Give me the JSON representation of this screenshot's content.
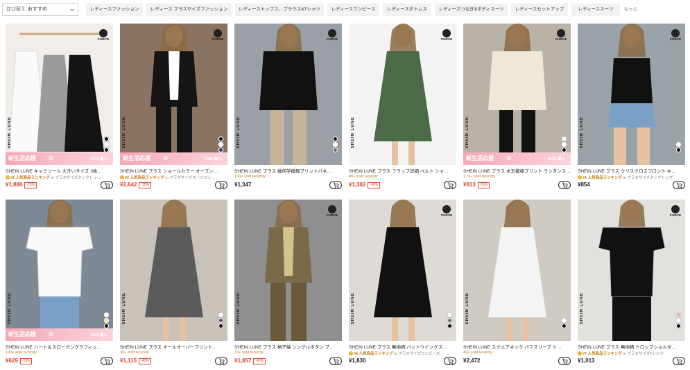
{
  "toolbar": {
    "sort_prefix": "並び替え",
    "sort_value": "おすすめ",
    "chips": [
      "レディースファッション",
      "レディース プラスサイズファッション",
      "レディーストップス、ブラウス&Tシャツ",
      "レディースワンピース",
      "レディースボトムス",
      "レディースつなぎ&ボディスーツ",
      "レディースセットアップ",
      "レディーススーツ"
    ],
    "more_label": "もっと"
  },
  "badges": {
    "curve_label": "CURVE",
    "brand_vertical": "SHEIN LUNE",
    "promo_label": "新生活応援"
  },
  "colors": {
    "sale_price": "#e0442b",
    "sold_orange": "#c47a18",
    "promo_pink": "#f7a8b6"
  },
  "products": [
    {
      "title": "SHEIN LUNE キャミソール 大きいサイズ 3枚…",
      "sub_type": "rank",
      "sub_text": "#1 人気商品ランキング",
      "sub_cat": "in プラスサイズタンクトッ…",
      "price": "¥1,886",
      "discount": "-15%",
      "promo_count": "2333 購入",
      "curve": true,
      "swatches": [
        "#111111",
        "#ffffff",
        "#111111"
      ]
    },
    {
      "title": "SHEIN LUNE プラス ショールカラー オープン…",
      "sub_type": "rank",
      "sub_text": "#2 人気商品ランキング",
      "sub_cat": "in プラスサイズスーツセッ…",
      "price": "¥2,642",
      "discount": "-15%",
      "promo_count": "2466 購入",
      "curve": true,
      "swatches": [
        "#111111",
        "#ffffff",
        "#1f3b7a"
      ]
    },
    {
      "title": "SHEIN LUNE プラス 幾何学模様プリントパネ…",
      "sub_type": "sold",
      "sub_text": "100+ sold recently",
      "sub_cat": "",
      "price": "¥1,347",
      "discount": "",
      "promo_count": "",
      "curve": true,
      "swatches": [
        "#111111",
        "#ffffff",
        "#6d6d6d"
      ]
    },
    {
      "title": "SHEIN LUNE プラス フラップ詳細 ベルト シャ…",
      "sub_type": "sold",
      "sub_text": "90+ sold recently",
      "sub_cat": "",
      "price": "¥1,382",
      "discount": "-40%",
      "promo_count": "",
      "curve": true,
      "swatches": []
    },
    {
      "title": "SHEIN LUNE プラス 水玉模様プリント ランタンスリ…",
      "sub_type": "sold",
      "sub_text": "1.7k+ sold recently",
      "sub_cat": "",
      "price": "¥913",
      "discount": "-15%",
      "promo_count": "5161 購入",
      "curve": true,
      "swatches": [
        "#f3efe3",
        "#ffffff",
        "#111111"
      ]
    },
    {
      "title": "SHEIN LUNE プラス クリスクロスフロント キ…",
      "sub_type": "rank",
      "sub_text": "#1 人気商品ランキング",
      "sub_cat": "in プラスサイズタンクトップ",
      "price": "¥854",
      "discount": "",
      "promo_count": "",
      "curve": true,
      "swatches": [
        "#ffffff",
        "#111111"
      ]
    },
    {
      "title": "SHEIN LUNE ハート＆スローガングラフィッ…",
      "sub_type": "sold",
      "sub_text": "100+ sold recently",
      "sub_cat": "",
      "price": "¥629",
      "discount": "-15%",
      "promo_count": "2111 購入",
      "curve": false,
      "swatches": [
        "#ffffff",
        "#efe6a6",
        "#111111"
      ]
    },
    {
      "title": "SHEIN LUNE プラス オールオーバープリント…",
      "sub_type": "sold",
      "sub_text": "30+ sold recently",
      "sub_cat": "",
      "price": "¥1,115",
      "discount": "-40%",
      "promo_count": "",
      "curve": false,
      "swatches": [
        "#ffffff",
        "#5d4a3a",
        "#111111"
      ]
    },
    {
      "title": "SHEIN LUNE プラス 格子縞 シングルボタン ブ…",
      "sub_type": "sold",
      "sub_text": "70+ sold recently",
      "sub_cat": "",
      "price": "¥1,857",
      "discount": "-40%",
      "promo_count": "",
      "curve": true,
      "swatches": []
    },
    {
      "title": "SHEIN LUNE プラス 無地柄 バットウイングス…",
      "sub_type": "rank",
      "sub_text": "#4 人気商品ランキング",
      "sub_cat": "in プラスサイズワンピース",
      "price": "¥1,830",
      "discount": "",
      "promo_count": "",
      "curve": true,
      "swatches": [
        "#ffffff",
        "#6c6c6c",
        "#111111"
      ]
    },
    {
      "title": "SHEIN LUNE スクエアネック パフスリーブ ト…",
      "sub_type": "sold",
      "sub_text": "40+ sold recently",
      "sub_cat": "",
      "price": "¥2,472",
      "discount": "",
      "promo_count": "",
      "curve": false,
      "swatches": [
        "#ffffff",
        "#111111"
      ]
    },
    {
      "title": "SHEIN LUNE プラス 無地柄 ドロップショルダ…",
      "sub_type": "rank",
      "sub_text": "#7 人気商品ランキング",
      "sub_cat": "in プラスサイズTシャツ",
      "price": "¥1,013",
      "discount": "",
      "promo_count": "",
      "curve": true,
      "swatches": [
        "#e8a3b0",
        "#ffffff",
        "#111111"
      ]
    }
  ]
}
